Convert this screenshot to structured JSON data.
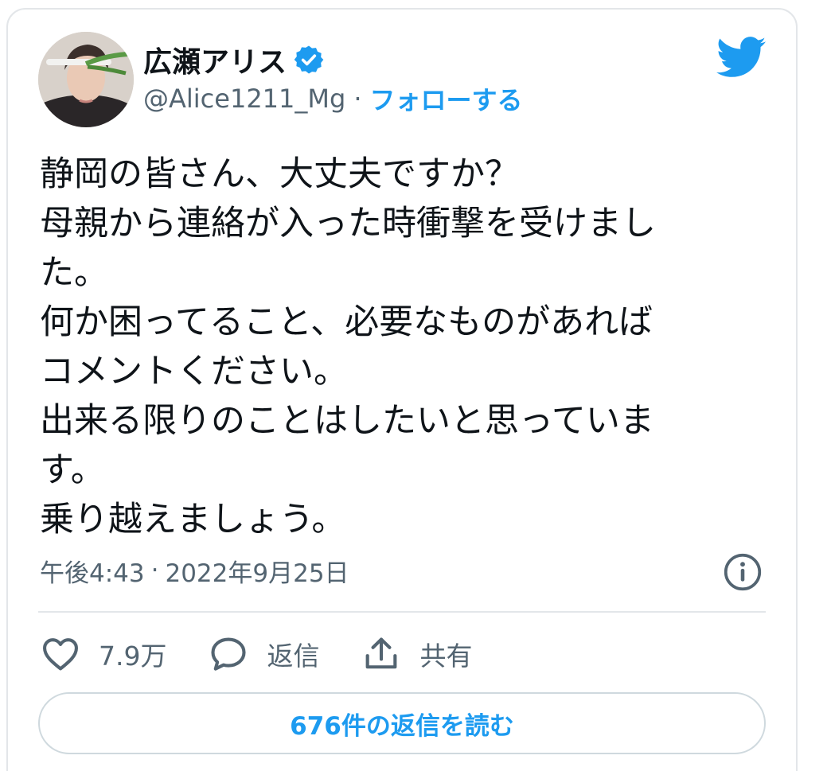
{
  "author": {
    "display_name": "広瀬アリス",
    "handle": "@Alice1211_Mg",
    "separator": "·",
    "follow_label": "フォローする"
  },
  "tweet": {
    "lines": [
      "静岡の皆さん、大丈夫ですか？",
      "母親から連絡が入った時衝撃を受けまし",
      "た。",
      "何か困ってること、必要なものがあれば",
      "コメントください。",
      "出来る限りのことはしたいと思っていま",
      "す。",
      "乗り越えましょう。"
    ],
    "time": "午後4:43",
    "separator": "·",
    "date": "2022年9月25日"
  },
  "actions": {
    "like_count": "7.9万",
    "reply_label": "返信",
    "share_label": "共有"
  },
  "read_replies_label": "676件の返信を読む",
  "colors": {
    "accent": "#1d9bf0",
    "secondary_text": "#536471",
    "border": "#e3e6e9"
  },
  "icons": {
    "verified": "verified-badge-icon",
    "brand": "twitter-bird-icon",
    "info": "info-icon",
    "like": "heart-icon",
    "reply": "speech-bubble-icon",
    "share": "share-icon"
  }
}
